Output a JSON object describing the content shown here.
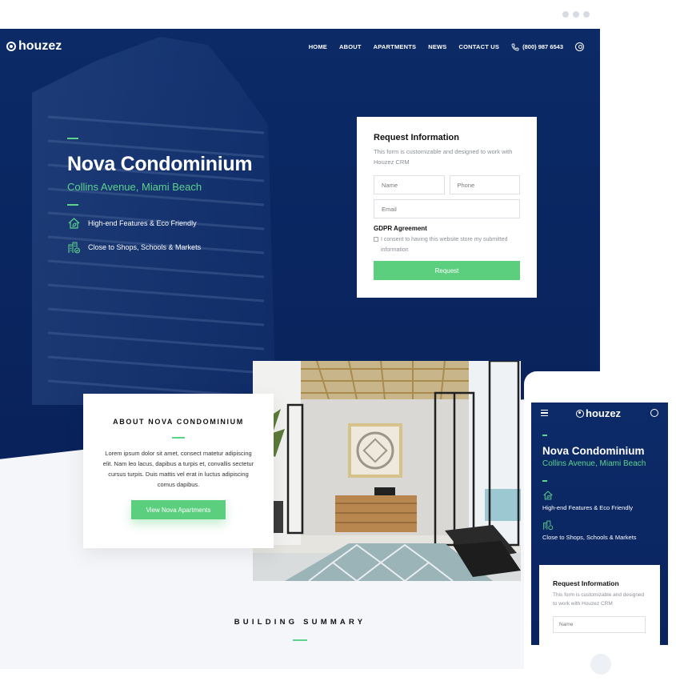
{
  "nav": {
    "logo": "houzez",
    "items": [
      "HOME",
      "ABOUT",
      "APARTMENTS",
      "NEWS",
      "CONTACT US"
    ],
    "phone": "(800) 987 6543"
  },
  "hero": {
    "title": "Nova Condominium",
    "subtitle": "Collins Avenue, Miami Beach",
    "features": [
      "High-end Features & Eco Friendly",
      "Close to Shops, Schools & Markets"
    ]
  },
  "form": {
    "title": "Request Information",
    "description": "This form is customizable and designed to work with Houzez CRM",
    "name_placeholder": "Name",
    "phone_placeholder": "Phone",
    "email_placeholder": "Email",
    "gdpr_title": "GDPR Agreement",
    "gdpr_text": "I consent to having this website store my submitted information",
    "submit_label": "Request"
  },
  "about": {
    "title": "ABOUT NOVA CONDOMINIUM",
    "body": "Lorem ipsum dolor sit amet, consect matetur adipiscing elit. Nam leo lacus, dapibus a turpis et, convallis sectetur cursus turpis. Duis mattis vel erat in luctus adipiscing comus dapibus.",
    "button_label": "View Nova Apartments"
  },
  "summary": {
    "title": "BUILDING SUMMARY"
  },
  "mobile": {
    "logo": "houzez",
    "title": "Nova Condominium",
    "subtitle": "Collins Avenue, Miami Beach",
    "features": [
      "High-end Features & Eco Friendly",
      "Close to Shops, Schools & Markets"
    ],
    "form_title": "Request Information",
    "form_description": "This form is customizable and designed to work with Houzez CRM",
    "name_placeholder": "Name"
  },
  "colors": {
    "navy": "#0b2a66",
    "accent": "#5ccf7f"
  }
}
